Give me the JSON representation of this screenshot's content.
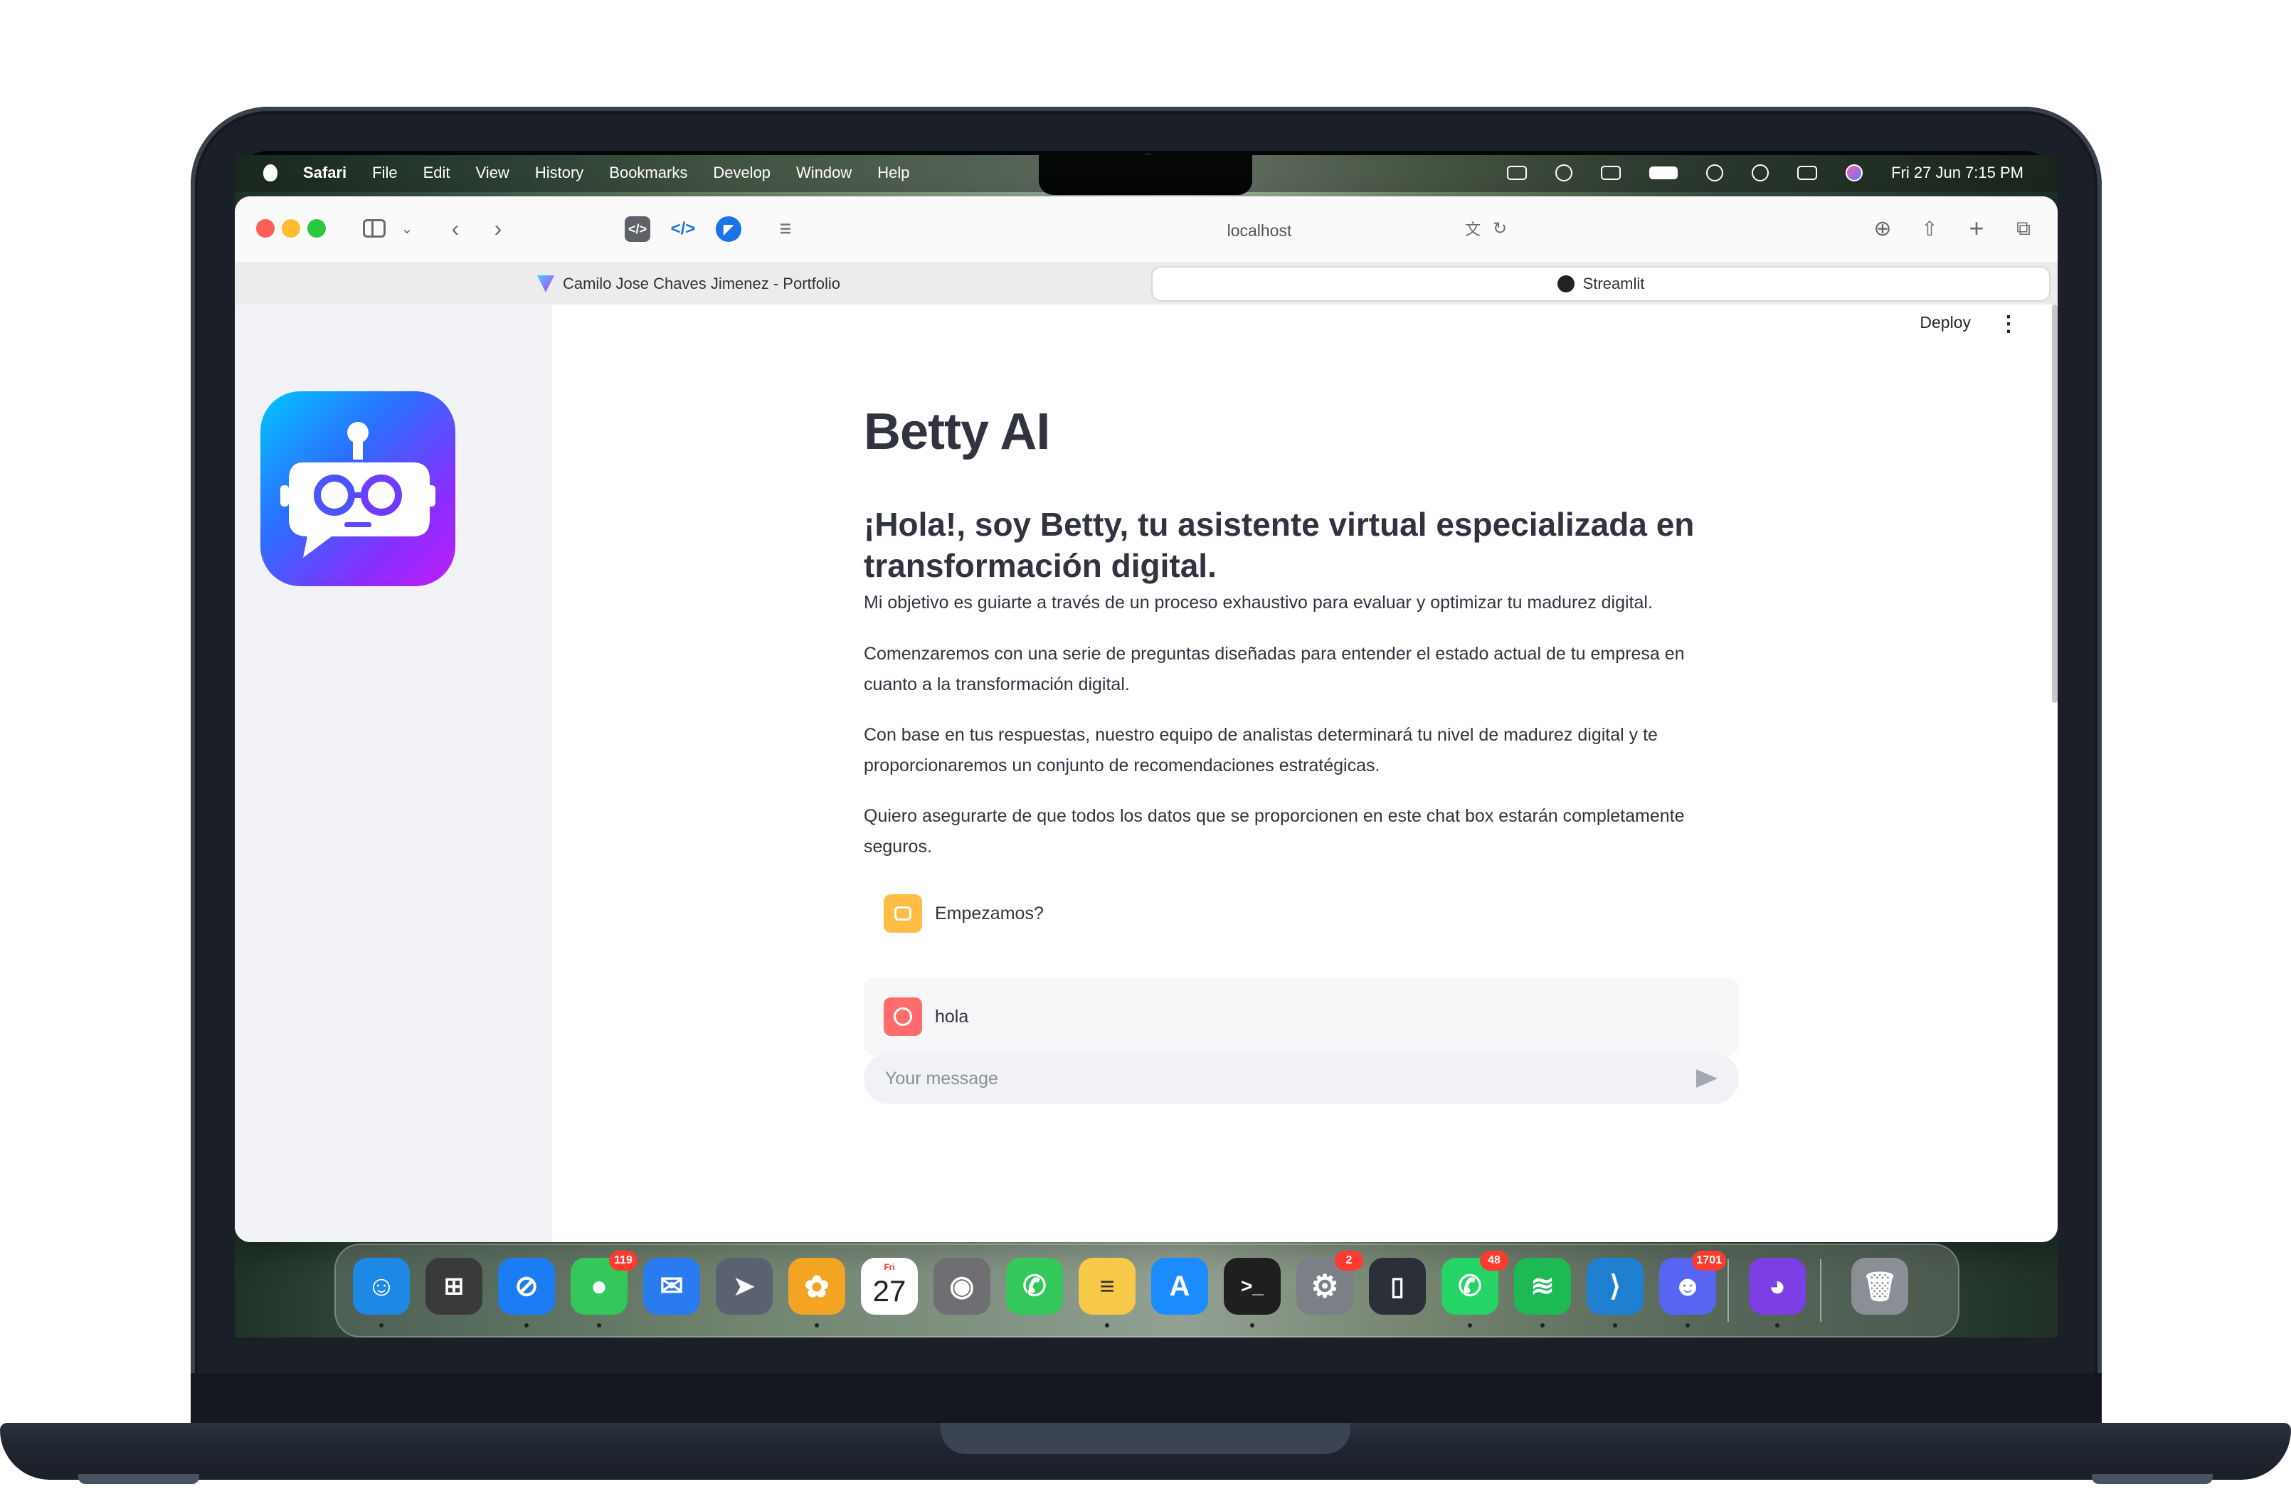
{
  "menubar": {
    "app": "Safari",
    "menus": [
      "File",
      "Edit",
      "View",
      "History",
      "Bookmarks",
      "Develop",
      "Window",
      "Help"
    ],
    "clock": "Fri 27 Jun  7:15 PM"
  },
  "browser": {
    "address": "localhost",
    "tabs": [
      {
        "title": "Camilo Jose Chaves Jimenez - Portfolio"
      },
      {
        "title": "Streamlit"
      }
    ]
  },
  "streamlit": {
    "deploy_label": "Deploy",
    "menu_glyph": "⋮",
    "title": "Betty AI",
    "subtitle": "¡Hola!, soy Betty, tu asistente virtual especializada en transformación digital.",
    "paragraphs": [
      "Mi objetivo es guiarte a través de un proceso exhaustivo para evaluar y optimizar tu madurez digital.",
      "Comenzaremos con una serie de preguntas diseñadas para entender el estado actual de tu empresa en cuanto a la transformación digital.",
      "Con base en tus respuestas, nuestro equipo de analistas determinará tu nivel de madurez digital y te proporcionaremos un conjunto de recomendaciones estratégicas.",
      "Quiero asegurarte de que todos los datos que se proporcionen en este chat box estarán completamente seguros."
    ],
    "messages": [
      {
        "role": "assistant",
        "text": "Empezamos?"
      },
      {
        "role": "user",
        "text": "hola"
      }
    ],
    "chat_placeholder": "Your message"
  },
  "dock": {
    "apps": [
      {
        "name": "Finder",
        "icon": "finder-icon",
        "color": "#1e88e5"
      },
      {
        "name": "Launchpad",
        "icon": "launchpad-icon",
        "color": "#3a3a3c"
      },
      {
        "name": "Safari",
        "icon": "safari-icon",
        "color": "#1c7cf4"
      },
      {
        "name": "Messages",
        "icon": "messages-icon",
        "color": "#34c759",
        "badge": "119"
      },
      {
        "name": "Mail",
        "icon": "mail-icon",
        "color": "#2a7af0"
      },
      {
        "name": "Maps",
        "icon": "maps-icon",
        "color": "#5a6170"
      },
      {
        "name": "Photos",
        "icon": "photos-icon",
        "color": "#f4a423"
      },
      {
        "name": "Calendar",
        "icon": "calendar-icon",
        "color": "#ffffff",
        "day": "Fri",
        "date": "27"
      },
      {
        "name": "Contacts",
        "icon": "contacts-icon",
        "color": "#6e6e73"
      },
      {
        "name": "Phone",
        "icon": "phone-icon",
        "color": "#34c759"
      },
      {
        "name": "Notes",
        "icon": "notes-icon",
        "color": "#f7c948"
      },
      {
        "name": "App Store",
        "icon": "app-store-icon",
        "color": "#1a8cff"
      },
      {
        "name": "Terminal",
        "icon": "terminal-icon",
        "color": "#1f1f1f"
      },
      {
        "name": "System Settings",
        "icon": "settings-icon",
        "color": "#7b7f86",
        "badge": "2"
      },
      {
        "name": "Simulator",
        "icon": "simulator-icon",
        "color": "#2b2f38"
      },
      {
        "name": "WhatsApp",
        "icon": "whatsapp-icon",
        "color": "#25d366",
        "badge": "48"
      },
      {
        "name": "Spotify",
        "icon": "spotify-icon",
        "color": "#1db954"
      },
      {
        "name": "VS Code",
        "icon": "vscode-icon",
        "color": "#1f7fd1"
      },
      {
        "name": "Discord",
        "icon": "discord-icon",
        "color": "#5865f2",
        "badge": "1701"
      },
      {
        "name": "GitHub Desktop",
        "icon": "github-icon",
        "color": "#7b3fe4"
      },
      {
        "name": "Trash",
        "icon": "trash-icon",
        "color": "#8a8f96"
      }
    ]
  }
}
